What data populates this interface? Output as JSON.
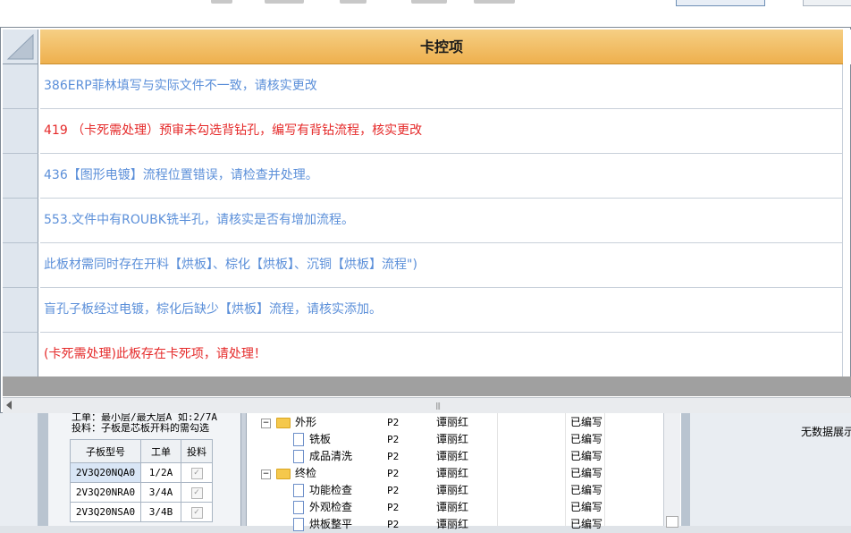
{
  "dialog": {
    "column_header": "卡控项",
    "rows": [
      {
        "text": "386ERP菲林填写与实际文件不一致，请核实更改",
        "color": "#5b8fd9"
      },
      {
        "text": "419 （卡死需处理）预审未勾选背钻孔，编写有背钻流程，核实更改",
        "color": "#e52a2a"
      },
      {
        "text": "436【图形电镀】流程位置错误，请检查并处理。",
        "color": "#5b8fd9"
      },
      {
        "text": "553.文件中有ROUBK铣半孔，请核实是否有增加流程。",
        "color": "#5b8fd9"
      },
      {
        "text": "此板材需同时存在开料【烘板】、棕化【烘板】、沉铜【烘板】流程\")",
        "color": "#5b8fd9"
      },
      {
        "text": "盲孔子板经过电镀，棕化后缺少【烘板】流程，请核实添加。",
        "color": "#5b8fd9"
      },
      {
        "text": "(卡死需处理)此板存在卡死项，请处理！",
        "color": "#e52a2a"
      }
    ],
    "scroll_grip": "|||"
  },
  "background_app": {
    "info_line1": "工单：最小层/最大层A 如:2/7A",
    "info_line2": "投料：子板是芯板开料的需勾选",
    "sub_table": {
      "headers": [
        "子板型号",
        "工单",
        "投料"
      ],
      "rows": [
        {
          "model": "2V3Q20NQA0",
          "order": "1/2A",
          "feed": "✓"
        },
        {
          "model": "2V3Q20NRA0",
          "order": "3/4A",
          "feed": "✓"
        },
        {
          "model": "2V3Q20NSA0",
          "order": "3/4B",
          "feed": "✓"
        }
      ]
    },
    "tree_rows": [
      {
        "name": "外形",
        "kind": "folder",
        "code": "P2",
        "person": "谭丽红",
        "status": "已编写"
      },
      {
        "name": "铣板",
        "kind": "doc",
        "code": "P2",
        "person": "谭丽红",
        "status": "已编写"
      },
      {
        "name": "成品清洗",
        "kind": "doc",
        "code": "P2",
        "person": "谭丽红",
        "status": "已编写"
      },
      {
        "name": "终检",
        "kind": "folder",
        "code": "P2",
        "person": "谭丽红",
        "status": "已编写"
      },
      {
        "name": "功能检查",
        "kind": "doc",
        "code": "P2",
        "person": "谭丽红",
        "status": "已编写"
      },
      {
        "name": "外观检查",
        "kind": "doc",
        "code": "P2",
        "person": "谭丽红",
        "status": "已编写"
      },
      {
        "name": "烘板整平",
        "kind": "doc",
        "code": "P2",
        "person": "谭丽红",
        "status": "已编写"
      }
    ],
    "no_data_text": "无数据展示"
  }
}
